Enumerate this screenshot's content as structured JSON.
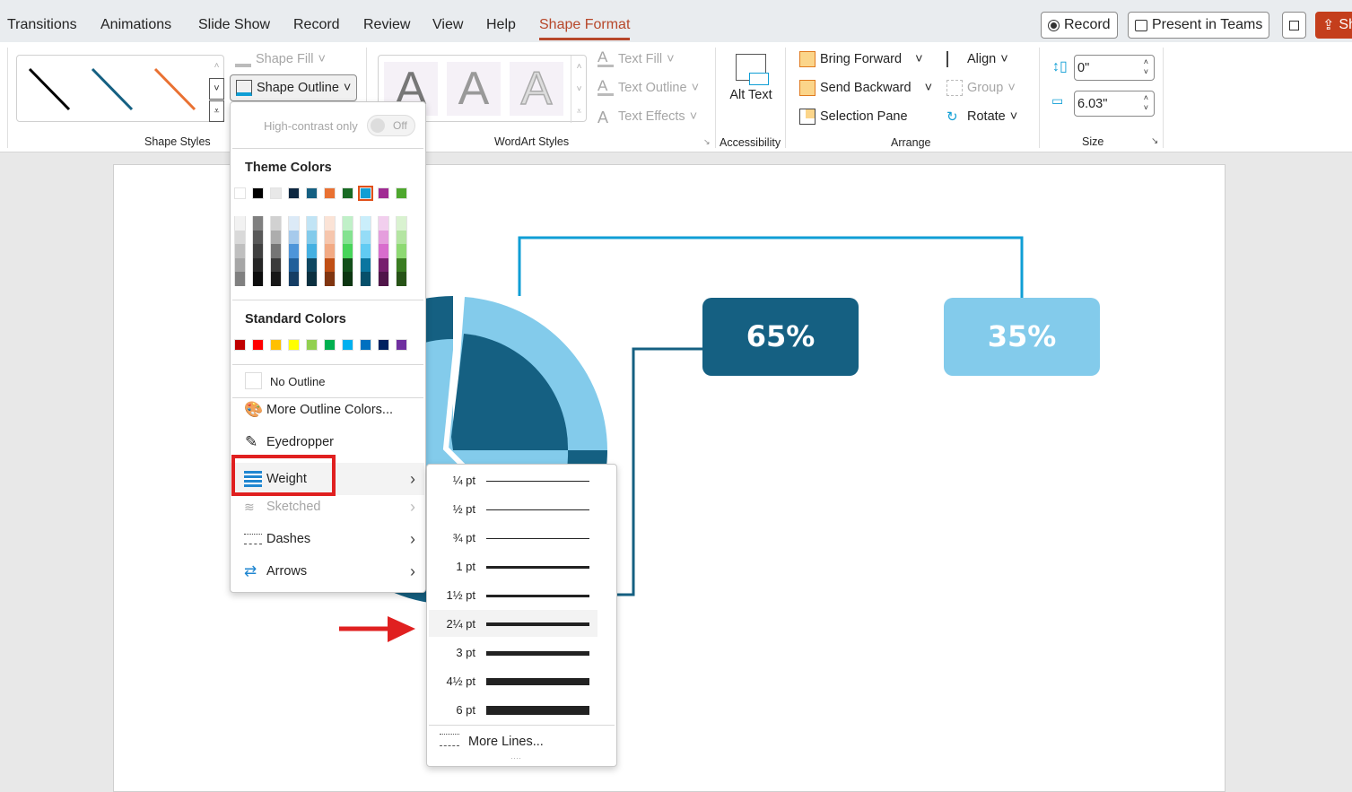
{
  "tabs": [
    "Transitions",
    "Animations",
    "Slide Show",
    "Record",
    "Review",
    "View",
    "Help",
    "Shape Format"
  ],
  "active_tab": "Shape Format",
  "top_buttons": {
    "record": "Record",
    "present": "Present in Teams",
    "share": "Sh"
  },
  "ribbon": {
    "shape_styles_label": "Shape Styles",
    "shape_fill": "Shape Fill",
    "shape_outline": "Shape Outline",
    "wordart_label": "WordArt Styles",
    "wordart_letter": "A",
    "text_fill": "Text Fill",
    "text_outline": "Text Outline",
    "text_effects": "Text Effects",
    "alt_text": "Alt Text",
    "accessibility_label": "Accessibility",
    "bring_forward": "Bring Forward",
    "send_backward": "Send Backward",
    "selection_pane": "Selection Pane",
    "align": "Align",
    "group": "Group",
    "rotate": "Rotate",
    "arrange_label": "Arrange",
    "height_value": "0\"",
    "width_value": "6.03\"",
    "size_label": "Size"
  },
  "outline_menu": {
    "high_contrast": "High-contrast only",
    "toggle": "Off",
    "theme_colors_label": "Theme Colors",
    "theme_colors": [
      "#FFFFFF",
      "#000000",
      "#E8E8E8",
      "#0E2841",
      "#156082",
      "#E97132",
      "#196B24",
      "#0F9ED5",
      "#A02B93",
      "#4EA72E"
    ],
    "selected_theme_color": "#0F9ED5",
    "theme_shades": [
      [
        "#F2F2F2",
        "#D9D9D9",
        "#BFBFBF",
        "#A6A6A6",
        "#808080"
      ],
      [
        "#808080",
        "#595959",
        "#404040",
        "#262626",
        "#0D0D0D"
      ],
      [
        "#D1D1D1",
        "#ADADAD",
        "#757575",
        "#3A3A3A",
        "#171717"
      ],
      [
        "#DCEAF7",
        "#A6CAEC",
        "#4E95D9",
        "#215F9A",
        "#153D64"
      ],
      [
        "#C1E4F5",
        "#83CBEB",
        "#45B0E1",
        "#0F4761",
        "#0B3040"
      ],
      [
        "#FBE3D6",
        "#F6C6AD",
        "#F2AA84",
        "#C04F15",
        "#803510"
      ],
      [
        "#C0F0C8",
        "#84E291",
        "#47D45A",
        "#124F1A",
        "#0C3511"
      ],
      [
        "#CAEEFB",
        "#95DCF7",
        "#61CBF3",
        "#0B76A0",
        "#074F6A"
      ],
      [
        "#F2CFEE",
        "#E59EDD",
        "#D86DCD",
        "#77206D",
        "#501549"
      ],
      [
        "#D9F2D0",
        "#B4E5A2",
        "#8ED973",
        "#3A7C22",
        "#275317"
      ]
    ],
    "standard_colors_label": "Standard Colors",
    "standard_colors": [
      "#C00000",
      "#FF0000",
      "#FFC000",
      "#FFFF00",
      "#92D050",
      "#00B050",
      "#00B0F0",
      "#0070C0",
      "#002060",
      "#7030A0"
    ],
    "no_outline": "No Outline",
    "more_colors": "More Outline Colors...",
    "eyedropper": "Eyedropper",
    "weight": "Weight",
    "sketched": "Sketched",
    "dashes": "Dashes",
    "arrows": "Arrows"
  },
  "weight_menu": {
    "items": [
      "¼ pt",
      "½ pt",
      "¾ pt",
      "1 pt",
      "1½ pt",
      "2¼ pt",
      "3 pt",
      "4½ pt",
      "6 pt"
    ],
    "highlighted": "2¼ pt",
    "more_lines": "More Lines..."
  },
  "slide": {
    "box1": "65%",
    "box2": "35%",
    "colors": {
      "dark": "#156082",
      "light": "#83CBEB",
      "connector": "#0F9ED5"
    }
  }
}
